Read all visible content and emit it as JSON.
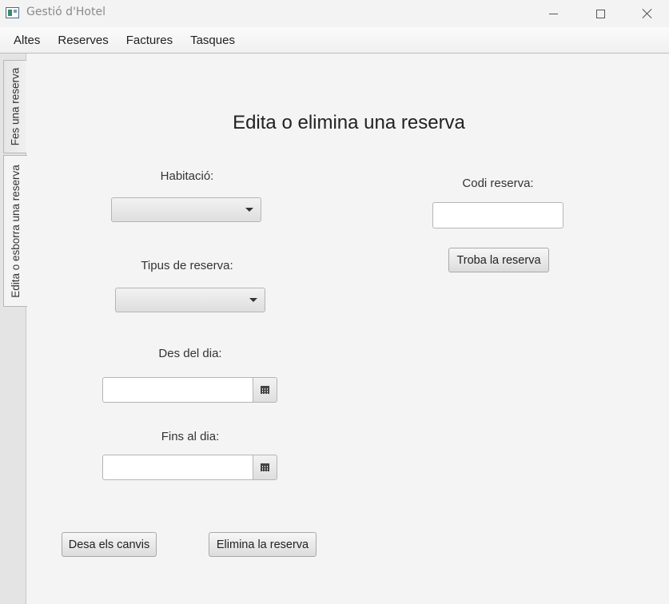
{
  "window": {
    "title": "Gestió d'Hotel"
  },
  "menu": [
    "Altes",
    "Reserves",
    "Factures",
    "Tasques"
  ],
  "tabs": [
    {
      "label": "Fes una reserva",
      "active": false
    },
    {
      "label": "Edita o esborra una reserva",
      "active": true
    }
  ],
  "form": {
    "title": "Edita o elimina una reserva",
    "room_label": "Habitació:",
    "room_value": "",
    "reservation_type_label": "Tipus de reserva:",
    "reservation_type_value": "",
    "from_date_label": "Des del dia:",
    "from_date_value": "",
    "to_date_label": "Fins al dia:",
    "to_date_value": "",
    "code_label": "Codi reserva:",
    "code_value": "",
    "find_button": "Troba la reserva",
    "save_button": "Desa els canvis",
    "delete_button": "Elimina la reserva"
  },
  "icons": {
    "app": "app-window-icon",
    "calendar": "calendar-icon",
    "dropdown": "chevron-down-icon"
  },
  "colors": {
    "background": "#f4f4f4",
    "tabstrip": "#e4e4e4",
    "border": "#b5b5b5",
    "text": "#333333"
  }
}
